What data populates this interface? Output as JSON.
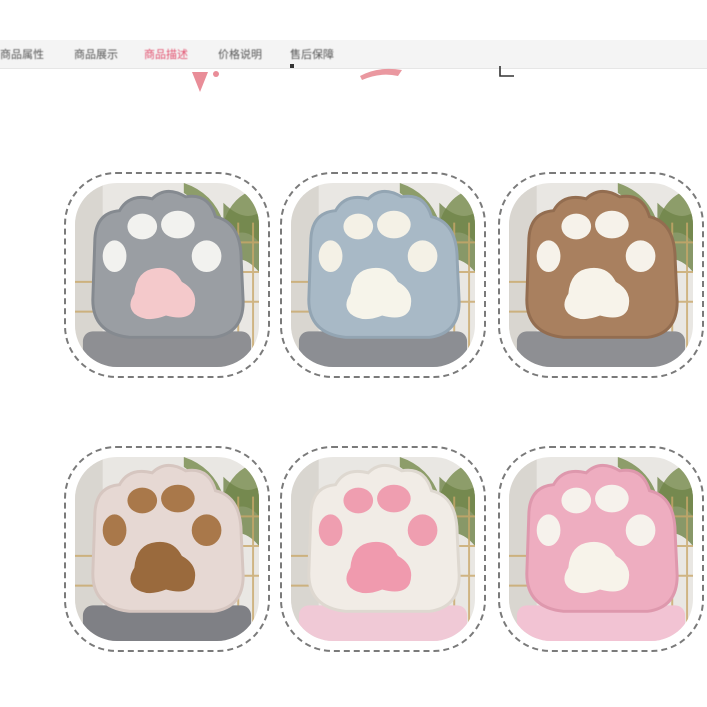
{
  "tabs": [
    {
      "label": "商品属性",
      "active": false
    },
    {
      "label": "商品展示",
      "active": false
    },
    {
      "label": "商品描述",
      "active": true
    },
    {
      "label": "价格说明",
      "active": false
    },
    {
      "label": "售后保障",
      "active": false
    }
  ],
  "products": [
    {
      "color_name": "grey",
      "fur": "#9a9ea3",
      "fur_shade": "#858a90",
      "pad": "#f2f2ef",
      "main_pad": "#f4c9cb",
      "blanket": "#8e8f93"
    },
    {
      "color_name": "light blue",
      "fur": "#a8b9c6",
      "fur_shade": "#93a5b3",
      "pad": "#f4f1e6",
      "main_pad": "#f6f4ea",
      "blanket": "#8c8e93"
    },
    {
      "color_name": "brown",
      "fur": "#a9805f",
      "fur_shade": "#936d50",
      "pad": "#f6f2ea",
      "main_pad": "#f7f3ea",
      "blanket": "#8e8f93"
    },
    {
      "color_name": "beige",
      "fur": "#e6d8d3",
      "fur_shade": "#d6c6c0",
      "pad": "#a9784a",
      "main_pad": "#9a6a3d",
      "blanket": "#7f8085"
    },
    {
      "color_name": "white",
      "fur": "#f1ece6",
      "fur_shade": "#ded8d0",
      "pad": "#ef9eb0",
      "main_pad": "#f09aae",
      "blanket": "#f0c9d6"
    },
    {
      "color_name": "pink",
      "fur": "#eeadc0",
      "fur_shade": "#de98ad",
      "pad": "#f6f2ec",
      "main_pad": "#f7f3ea",
      "blanket": "#f2c3d3"
    }
  ]
}
